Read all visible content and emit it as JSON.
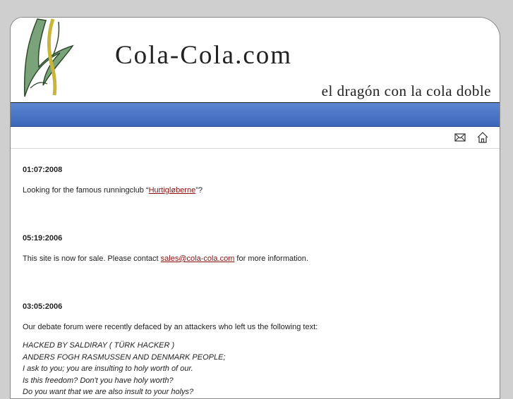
{
  "header": {
    "site_title": "Cola-Cola.com",
    "tagline": "el dragón con la cola doble"
  },
  "toolbar": {
    "mail_icon": "envelope-icon",
    "home_icon": "home-icon"
  },
  "colors": {
    "band_blue": "#4a74c4",
    "link_red": "#8b0f0f"
  },
  "entries": [
    {
      "date": "01:07:2008",
      "text_before": "Looking for the famous runningclub “",
      "link": "Hurtigløberne",
      "text_after": "”?"
    },
    {
      "date": "05:19:2006",
      "text_before": "This site is now for sale. Please contact ",
      "link": "sales@cola-cola.com",
      "text_after": " for more information."
    },
    {
      "date": "03:05:2006",
      "text": "Our debate forum were recently defaced by an attackers who left us the following text:",
      "quote": [
        "HACKED BY SALDIRAY ( TÜRK HACKER )",
        "ANDERS FOGH RASMUSSEN AND DENMARK PEOPLE;",
        "I ask to you; you are insulting to holy worth of our.",
        "Is this freedom? Don't you have holy worth?",
        "Do you want that we are also insult to your holys?"
      ]
    }
  ]
}
